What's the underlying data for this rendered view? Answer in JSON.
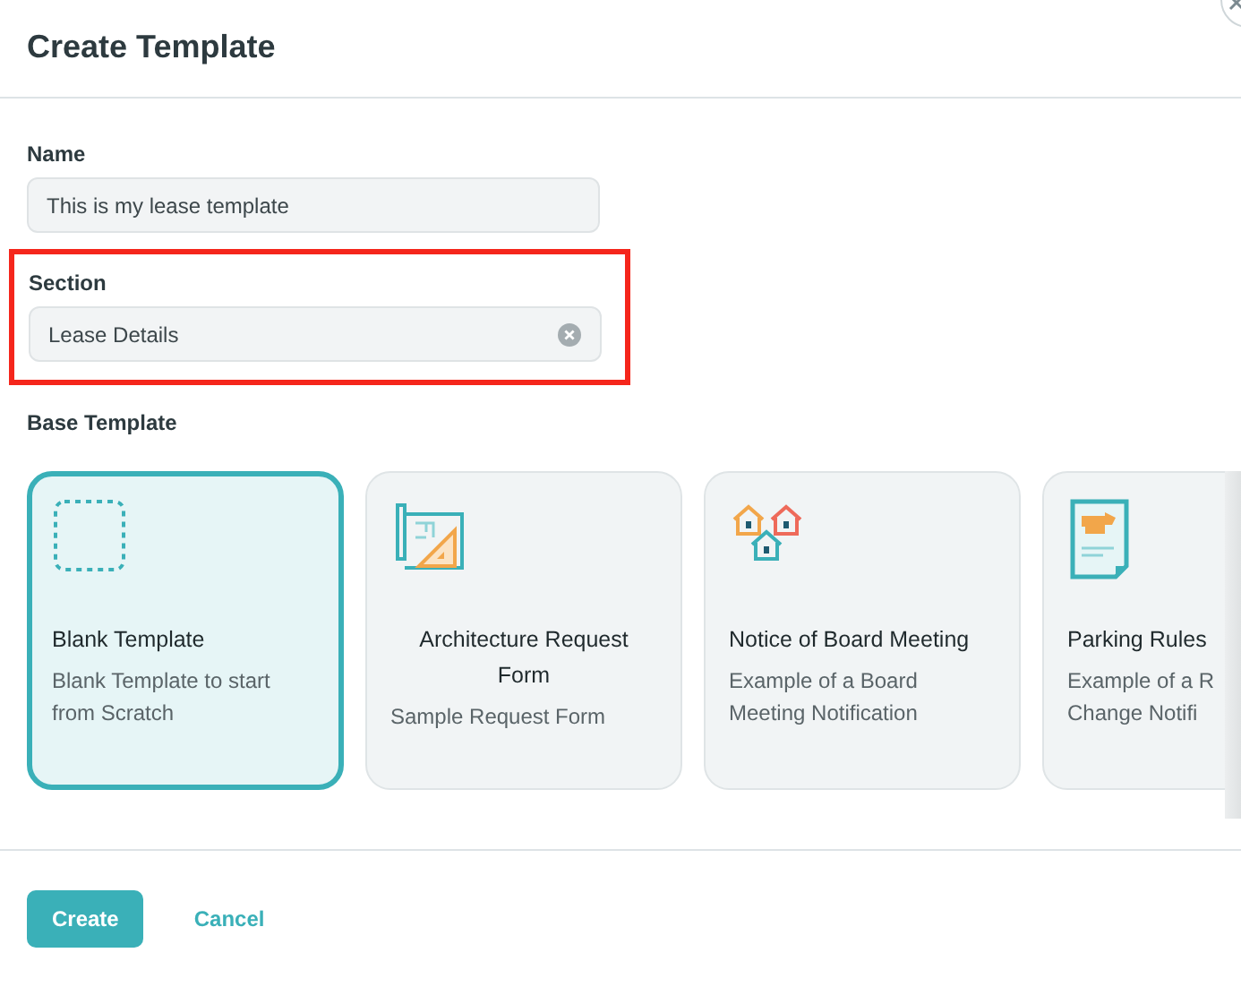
{
  "dialog": {
    "title": "Create Template"
  },
  "fields": [
    {
      "label": "Name",
      "value": "This is my lease template",
      "clearable": false,
      "highlighted": false
    },
    {
      "label": "Section",
      "value": "Lease Details",
      "clearable": true,
      "highlighted": true
    }
  ],
  "base_template": {
    "label": "Base Template",
    "cards": [
      {
        "kind": "blank",
        "title": "Blank Template",
        "description": "Blank Template to start from Scratch",
        "selected": true,
        "title_centered": false
      },
      {
        "kind": "blueprint",
        "title": "Architecture Request Form",
        "description": "Sample Request Form",
        "selected": false,
        "title_centered": true
      },
      {
        "kind": "houses",
        "title": "Notice of Board Meeting",
        "description": "Example of a Board Meeting Notification",
        "selected": false,
        "title_centered": false
      },
      {
        "kind": "document",
        "title": "Parking Rules",
        "description": "Example of a R\nChange Notifi",
        "selected": false,
        "title_centered": false
      }
    ]
  },
  "buttons": [
    {
      "kind": "primary",
      "label": "Create"
    },
    {
      "kind": "link",
      "label": "Cancel"
    }
  ]
}
